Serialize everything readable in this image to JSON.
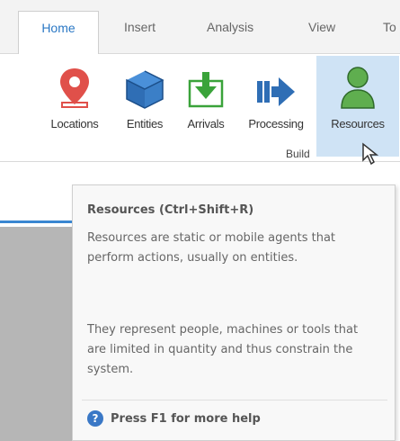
{
  "tabs": {
    "home": "Home",
    "insert": "Insert",
    "analysis": "Analysis",
    "view": "View",
    "tools": "To"
  },
  "ribbon": {
    "buttons": [
      {
        "label": "Locations",
        "icon": "map-pin-icon"
      },
      {
        "label": "Entities",
        "icon": "cube-icon"
      },
      {
        "label": "Arrivals",
        "icon": "arrival-arrow-icon"
      },
      {
        "label": "Processing",
        "icon": "processing-arrow-icon"
      },
      {
        "label": "Resources",
        "icon": "person-icon",
        "state": "hovered"
      }
    ],
    "group_label": "Build"
  },
  "tooltip": {
    "title": "Resources (Ctrl+Shift+R)",
    "paragraph1": "Resources are static or mobile agents that perform actions, usually on entities.",
    "paragraph2": "They represent people, machines or tools that are limited in quantity and thus constrain the system.",
    "help_text": "Press F1 for more help",
    "help_icon_glyph": "?"
  },
  "colors": {
    "accent_blue": "#2b78c5",
    "hover_highlight": "#cfe3f5",
    "location_red": "#e0504a",
    "arrival_green": "#3aa33a",
    "person_green": "#5fae4f"
  }
}
